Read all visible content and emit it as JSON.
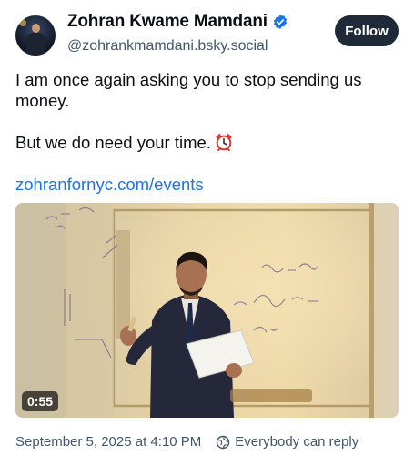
{
  "author": {
    "display_name": "Zohran Kwame Mamdani",
    "handle": "@zohrankmamdani.bsky.social",
    "verified_icon": "verified-checkmark-icon",
    "verified_color": "#1a73e8"
  },
  "actions": {
    "follow_label": "Follow"
  },
  "post": {
    "line1": "I am once again asking you to stop sending us money.",
    "line2": "But we do need your time.",
    "emoji": "⏰",
    "link_text": "zohranfornyc.com/events"
  },
  "video": {
    "duration": "0:55"
  },
  "footer": {
    "timestamp": "September 5, 2025 at 4:10 PM",
    "reply_setting": "Everybody can reply",
    "reply_icon": "globe-reply-icon"
  },
  "colors": {
    "link": "#1a73e8",
    "follow_bg": "#1f2937",
    "secondary_text": "#42576c"
  }
}
